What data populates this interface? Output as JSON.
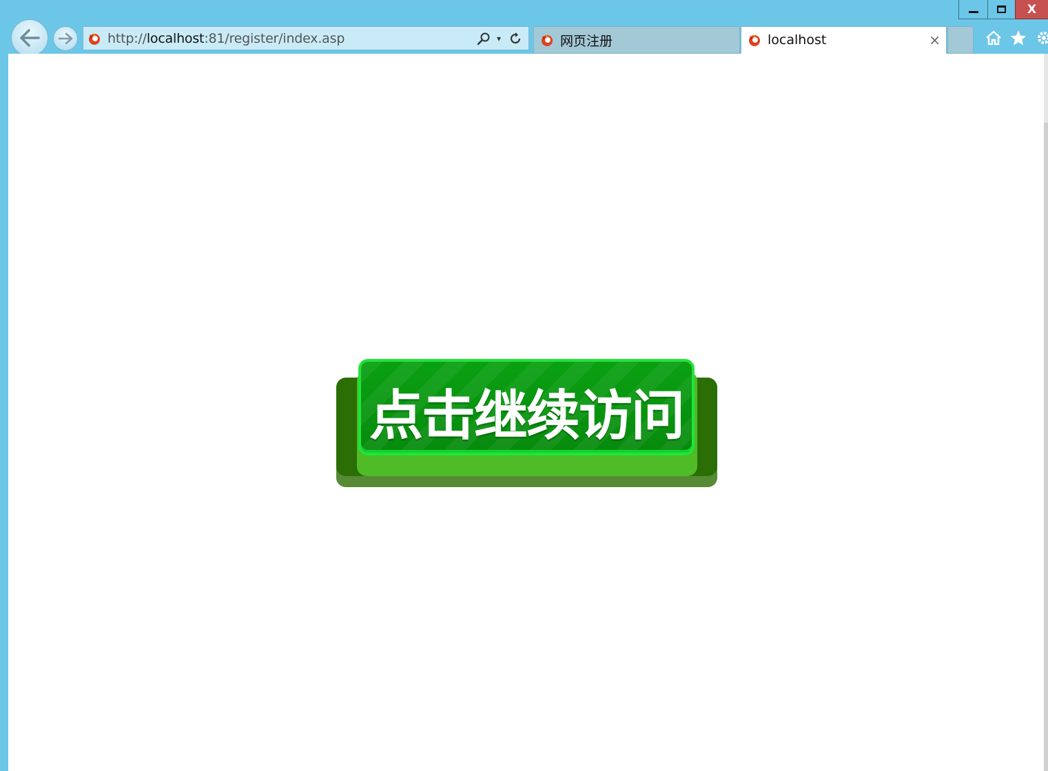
{
  "browser": {
    "address_bar": {
      "url_prefix": "http://",
      "url_host": "localhost",
      "url_rest": ":81/register/index.asp"
    },
    "tabs": [
      {
        "label": "网页注册",
        "active": false
      },
      {
        "label": "localhost",
        "active": true
      }
    ],
    "tab_close_glyph": "×",
    "window_close_glyph": "X",
    "addr_dropdown_glyph": "▾"
  },
  "page": {
    "continue_button_label": "点击继续访问"
  },
  "colors": {
    "chrome": "#6bc6e8",
    "button_face": "#078a0d",
    "button_base": "#2a6e05",
    "button_rim": "#21e43a",
    "window_close": "#c75050"
  },
  "icons": {
    "back": "arrow-left-icon",
    "forward": "arrow-right-icon",
    "site_favicon": "firefox-favicon-icon",
    "search": "magnifier-icon",
    "refresh": "refresh-icon",
    "home": "home-icon",
    "favorites": "star-icon",
    "settings": "gear-icon"
  }
}
